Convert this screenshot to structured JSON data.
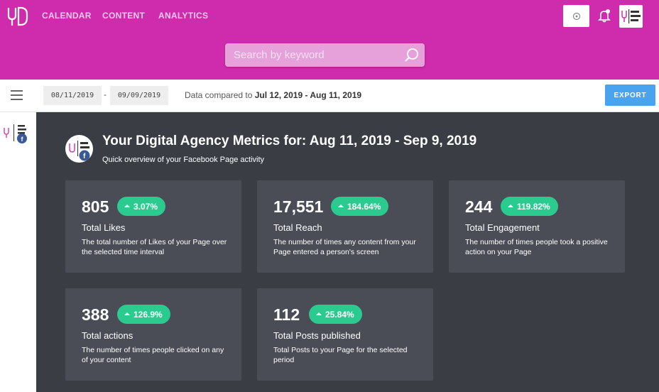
{
  "header": {
    "nav": [
      "CALENDAR",
      "CONTENT",
      "ANALYTICS"
    ],
    "search_placeholder": "Search by keyword",
    "brand_color": "#cf2cad"
  },
  "toolbar": {
    "start_date": "08/11/2019",
    "end_date": "09/09/2019",
    "compare_prefix": "Data compared to",
    "compare_range": "Jul 12, 2019 - Aug 11, 2019",
    "export_label": "EXPORT"
  },
  "main": {
    "title": "Your Digital Agency Metrics for: Aug 11, 2019 - Sep 9, 2019",
    "subtitle": "Quick overview of your Facebook Page activity",
    "cards": [
      {
        "value": "805",
        "change": "3.07%",
        "label": "Total Likes",
        "desc": "The total number of Likes of your Page over the selected time interval"
      },
      {
        "value": "17,551",
        "change": "184.64%",
        "label": "Total Reach",
        "desc": "The number of times any content from your Page entered a person's screen"
      },
      {
        "value": "244",
        "change": "119.82%",
        "label": "Total Engagement",
        "desc": "The number of times people took a positive action on your Page"
      },
      {
        "value": "388",
        "change": "126.9%",
        "label": "Total actions",
        "desc": "The number of times people clicked on any of your content"
      },
      {
        "value": "112",
        "change": "25.84%",
        "label": "Total Posts published",
        "desc": "Total Posts to your Page for the selected period"
      }
    ]
  },
  "icons": {
    "logo": "yd-logo-icon",
    "settings": "circle-dot-icon",
    "notifications": "bell-icon",
    "search": "search-icon",
    "menu": "hamburger-icon",
    "trend": "arrow-up-icon",
    "facebook": "facebook-icon"
  },
  "colors": {
    "accent_green": "#2bcb8f",
    "export_blue": "#4aa3ef",
    "panel_dark": "#3b3d45",
    "card_bg": "#4b4d56"
  }
}
